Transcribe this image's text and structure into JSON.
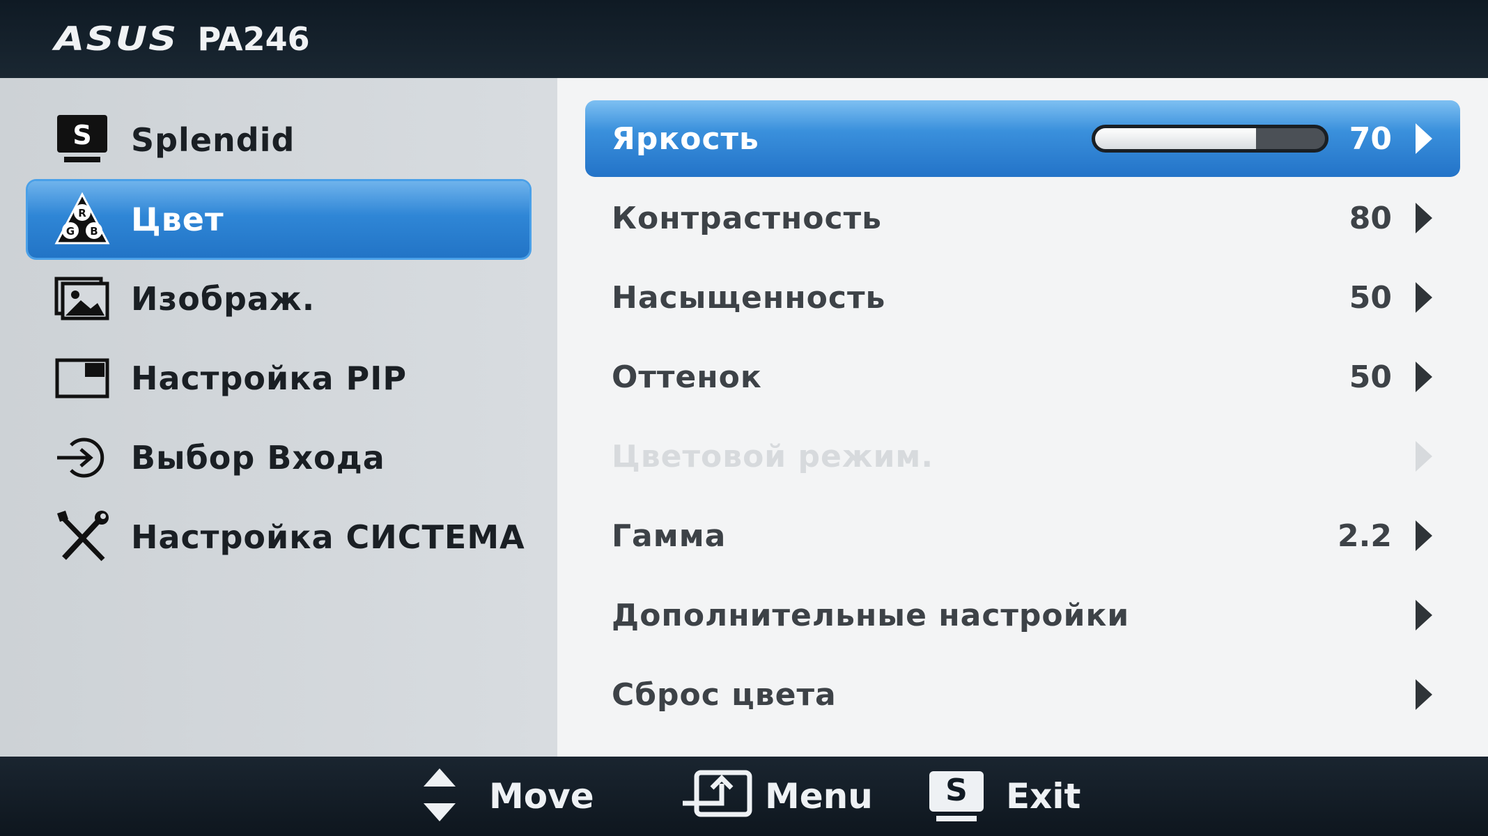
{
  "header": {
    "brand": "ASUS",
    "model": "PA246"
  },
  "sidebar": {
    "items": [
      {
        "label": "Splendid",
        "icon": "splendid-s-icon",
        "active": false
      },
      {
        "label": "Цвет",
        "icon": "rgb-color-icon",
        "active": true
      },
      {
        "label": "Изображ.",
        "icon": "image-icon",
        "active": false
      },
      {
        "label": "Настройка PIP",
        "icon": "pip-window-icon",
        "active": false
      },
      {
        "label": "Выбор Входа",
        "icon": "input-select-icon",
        "active": false
      },
      {
        "label": "Настройка СИСТЕМА",
        "icon": "tools-icon",
        "active": false
      }
    ]
  },
  "settings": {
    "rows": [
      {
        "label": "Яркость",
        "value": "70",
        "slider_fraction": 0.7,
        "active": true,
        "disabled": false
      },
      {
        "label": "Контрастность",
        "value": "80",
        "active": false,
        "disabled": false
      },
      {
        "label": "Насыщенность",
        "value": "50",
        "active": false,
        "disabled": false
      },
      {
        "label": "Оттенок",
        "value": "50",
        "active": false,
        "disabled": false
      },
      {
        "label": "Цветовой режим.",
        "value": "",
        "active": false,
        "disabled": true
      },
      {
        "label": "Гамма",
        "value": "2.2",
        "active": false,
        "disabled": false
      },
      {
        "label": "Дополнительные настройки",
        "value": "",
        "active": false,
        "disabled": false
      },
      {
        "label": "Сброс цвета",
        "value": "",
        "active": false,
        "disabled": false
      }
    ]
  },
  "footer": {
    "move_label": "Move",
    "menu_label": "Menu",
    "exit_label": "Exit",
    "exit_icon_letter": "S"
  },
  "colors": {
    "accent": "#2f86d6",
    "header_bg": "#0f1a24",
    "left_bg": "#d2d6da",
    "right_bg": "#f3f4f5"
  }
}
